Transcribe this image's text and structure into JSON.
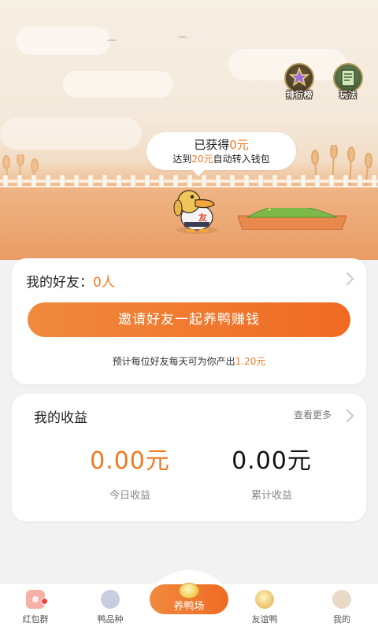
{
  "header": {
    "leaderboard_label": "排行榜",
    "gameplay_label": "玩法"
  },
  "bubble": {
    "line1_prefix": "已获得",
    "earned_amount": "0元",
    "line2_prefix": "达到",
    "threshold_amount": "20元",
    "line2_suffix": "自动转入钱包"
  },
  "duck_shirt_text": "友",
  "friends": {
    "label": "我的好友：",
    "count": "0人",
    "invite_button": "邀请好友一起养鸭赚钱",
    "estimate_prefix": "预计每位好友每天可为你产出",
    "estimate_amount": "1.20元"
  },
  "earnings": {
    "title": "我的收益",
    "more_label": "查看更多",
    "today_value": "0.00元",
    "today_label": "今日收益",
    "total_value": "0.00元",
    "total_label": "累计收益"
  },
  "tabbar": {
    "tab1": "红包群",
    "tab2": "鸭品种",
    "tab3": "养鸭场",
    "tab4": "友谊鸭",
    "tab5": "我的"
  },
  "colors": {
    "accent": "#f07a22",
    "button_gradient_start": "#f08a3e",
    "button_gradient_end": "#f06a22"
  }
}
